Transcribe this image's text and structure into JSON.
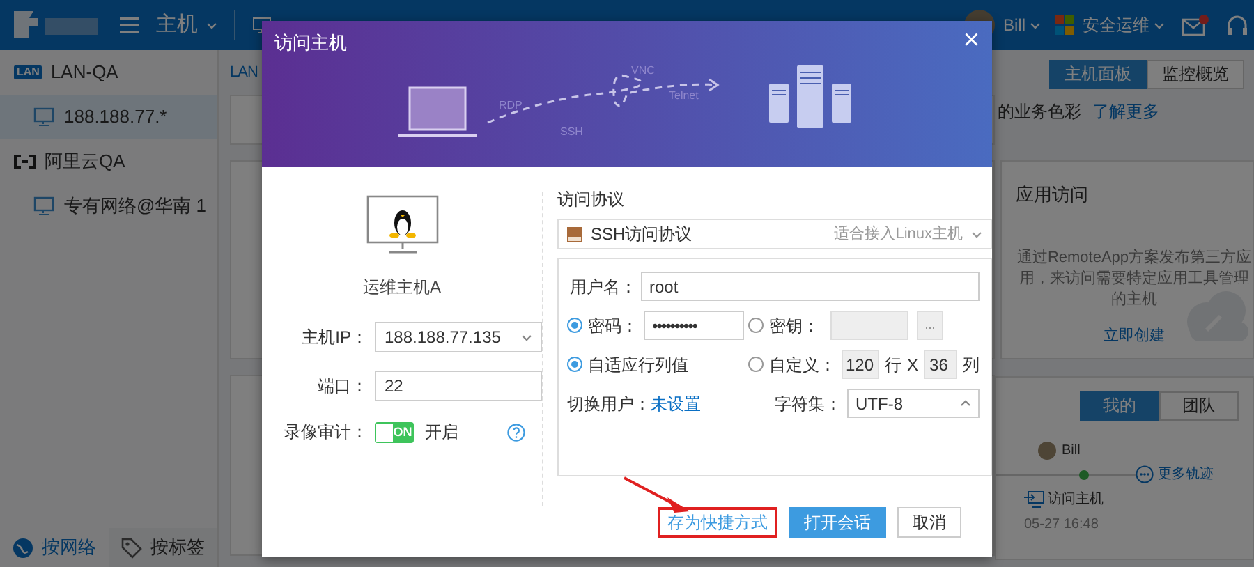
{
  "topbar": {
    "module": "主机",
    "user": "Bill",
    "product": "安全运维",
    "mail_unread": true
  },
  "sidebar": {
    "tree": [
      {
        "kind": "lan",
        "badge": "LAN",
        "label": "LAN-QA",
        "children": [
          {
            "label": "188.188.77.*",
            "selected": true
          }
        ]
      },
      {
        "kind": "cloud",
        "label": "阿里云QA",
        "children": [
          {
            "label": "专有网络@华南 1",
            "selected": false
          }
        ]
      }
    ],
    "tabs": [
      {
        "label": "按网络",
        "selected": true
      },
      {
        "label": "按标签",
        "selected": false
      }
    ]
  },
  "main": {
    "tab": "LAN",
    "view_tabs": [
      {
        "label": "主机面板",
        "selected": true
      },
      {
        "label": "监控概览",
        "selected": false
      }
    ],
    "hint": "的业务色彩",
    "hint_link": "了解更多",
    "app_card": {
      "title": "应用访问",
      "text": "通过RemoteApp方案发布第三方应用，来访问需要特定应用工具管理的主机",
      "link": "立即创建"
    },
    "activity": {
      "tabs": [
        {
          "label": "我的",
          "selected": true
        },
        {
          "label": "团队",
          "selected": false
        }
      ],
      "user": "Bill",
      "more": "更多轨迹",
      "action": "访问主机",
      "time": "05-27 16:48"
    }
  },
  "dialog": {
    "title": "访问主机",
    "close": "×",
    "banner_labels": [
      "RDP",
      "SSH",
      "VNC",
      "Telnet"
    ],
    "host": {
      "name": "运维主机A"
    },
    "fields": [
      {
        "label": "主机IP：",
        "value": "188.188.77.135",
        "kind": "select"
      },
      {
        "label": "端口：",
        "value": "22",
        "kind": "text"
      }
    ],
    "recording": {
      "label": "录像审计：",
      "on": true,
      "switch_text": "ON",
      "state": "开启"
    },
    "protocol": {
      "label": "访问协议",
      "value": "SSH访问协议",
      "hint": "适合接入Linux主机"
    },
    "username": {
      "label": "用户名：",
      "value": "root"
    },
    "auth": [
      {
        "label": "密码：",
        "selected": true,
        "value": "••••••••••"
      },
      {
        "label": "密钥：",
        "selected": false,
        "button": "..."
      }
    ],
    "size": [
      {
        "label": "自适应行列值",
        "selected": true
      },
      {
        "label": "自定义：",
        "selected": false,
        "rows": "120",
        "row_unit": "行",
        "times": "X",
        "cols": "36",
        "col_unit": "列"
      }
    ],
    "switch_user": {
      "label": "切换用户：",
      "link": "未设置"
    },
    "charset": {
      "label": "字符集：",
      "value": "UTF-8",
      "expanded": true
    },
    "buttons": [
      {
        "kind": "link",
        "label": "存为快捷方式",
        "highlighted": true
      },
      {
        "kind": "primary",
        "label": "打开会话"
      },
      {
        "kind": "default",
        "label": "取消"
      }
    ]
  }
}
